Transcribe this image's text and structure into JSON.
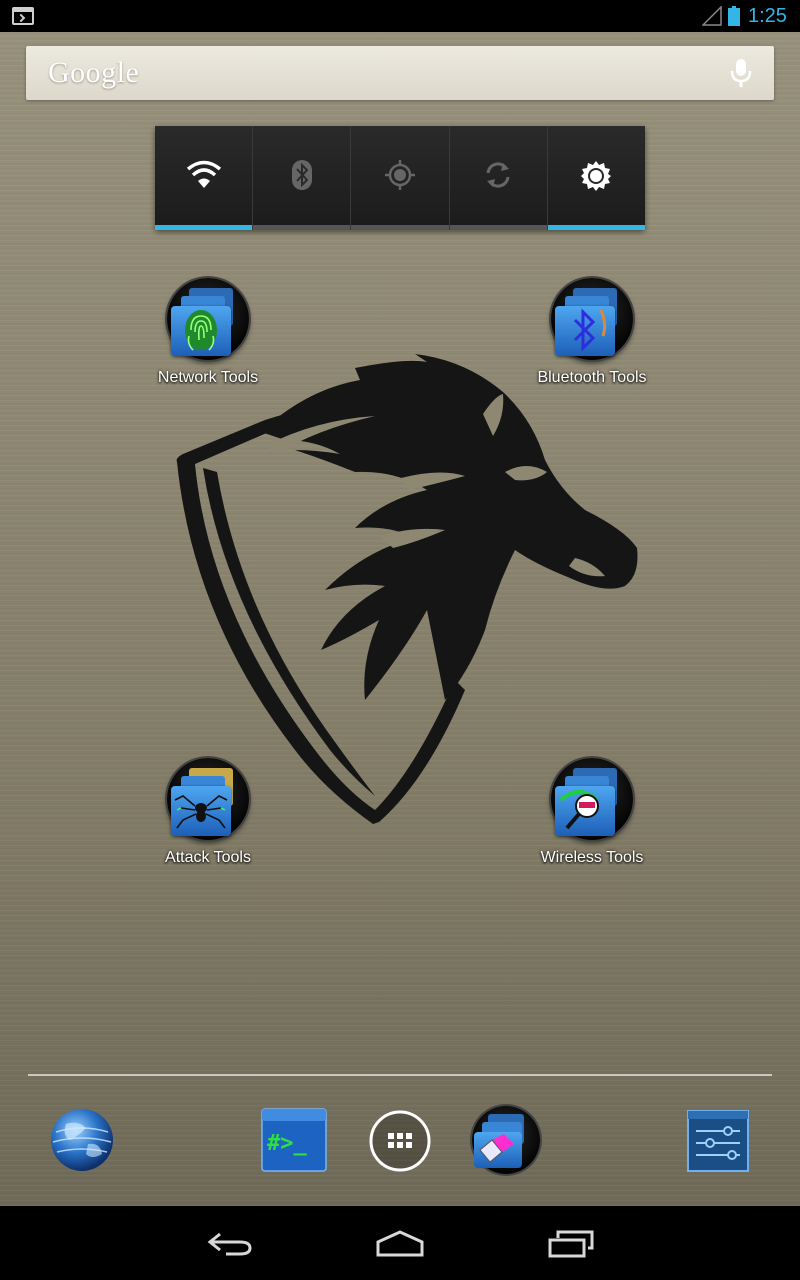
{
  "status_bar": {
    "time": "1:25",
    "notification_icon": "terminal-icon",
    "signal_icon": "signal-empty-icon",
    "battery_icon": "battery-icon",
    "accent_color": "#33b5e5"
  },
  "search": {
    "logo_text": "Google",
    "voice_icon": "mic-icon"
  },
  "power_widget": {
    "toggles": [
      {
        "name": "wifi",
        "icon": "wifi-icon",
        "state": "on"
      },
      {
        "name": "bluetooth",
        "icon": "bluetooth-icon",
        "state": "off"
      },
      {
        "name": "gps",
        "icon": "gps-icon",
        "state": "off"
      },
      {
        "name": "sync",
        "icon": "sync-icon",
        "state": "off"
      },
      {
        "name": "brightness",
        "icon": "brightness-icon",
        "state": "on"
      }
    ]
  },
  "home_icons": [
    {
      "label": "Network Tools",
      "icon": "fingerprint-folder-icon"
    },
    {
      "label": "Bluetooth Tools",
      "icon": "bluetooth-folder-icon"
    },
    {
      "label": "Attack Tools",
      "icon": "spider-folder-icon"
    },
    {
      "label": "Wireless Tools",
      "icon": "wifi-ssid-folder-icon"
    }
  ],
  "wallpaper": {
    "logo": "horse-shield-logo",
    "base_color": "#8d8772"
  },
  "dock": {
    "items": [
      {
        "icon": "globe-icon"
      },
      {
        "icon": "terminal-app-icon"
      },
      {
        "icon": "all-apps-icon"
      },
      {
        "icon": "eraser-folder-icon"
      },
      {
        "icon": "settings-sliders-icon"
      }
    ]
  },
  "nav_bar": {
    "buttons": [
      {
        "icon": "back-icon"
      },
      {
        "icon": "home-icon"
      },
      {
        "icon": "recents-icon"
      }
    ]
  }
}
